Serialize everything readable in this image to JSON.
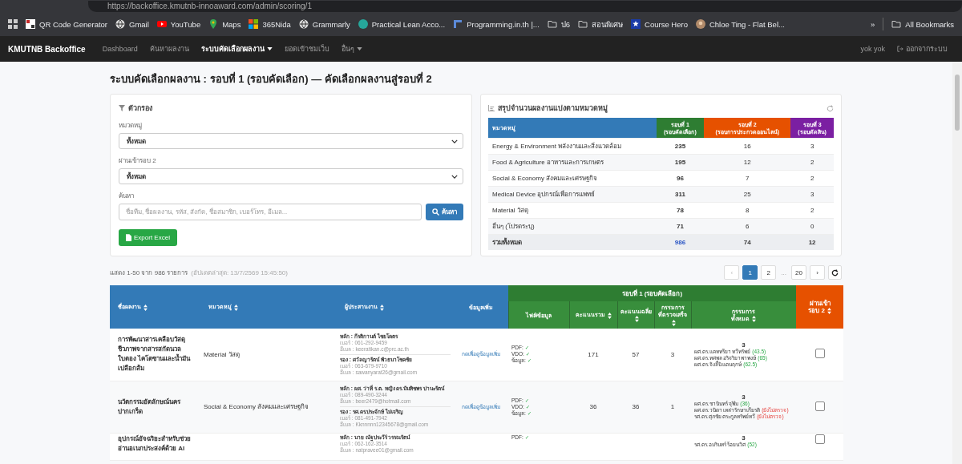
{
  "browser": {
    "url": "https://backoffice.kmutnb-innoaward.com/admin/scoring/1",
    "bookmarks": [
      {
        "label": "QR Code Generator",
        "kind": "qr"
      },
      {
        "label": "Gmail",
        "kind": "globe"
      },
      {
        "label": "YouTube",
        "kind": "play"
      },
      {
        "label": "Maps",
        "kind": "pin"
      },
      {
        "label": "365Nida",
        "kind": "grid"
      },
      {
        "label": "Grammarly",
        "kind": "globe"
      },
      {
        "label": "Practical Lean Acco...",
        "kind": "app"
      },
      {
        "label": "Programming.in.th |...",
        "kind": "page"
      },
      {
        "label": "ป6",
        "kind": "folder"
      },
      {
        "label": "สอนพิเศษ",
        "kind": "folder"
      },
      {
        "label": "Course Hero",
        "kind": "star"
      },
      {
        "label": "Chloe Ting - Flat Bel...",
        "kind": "avatar"
      }
    ],
    "more": "»",
    "all_bookmarks": "All Bookmarks"
  },
  "navbar": {
    "brand": "KMUTNB Backoffice",
    "items": [
      {
        "label": "Dashboard",
        "selected": false,
        "dropdown": false
      },
      {
        "label": "ค้นหาผลงาน",
        "selected": false,
        "dropdown": false
      },
      {
        "label": "ระบบคัดเลือกผลงาน",
        "selected": true,
        "dropdown": true
      },
      {
        "label": "ยอดเข้าชมเว็บ",
        "selected": false,
        "dropdown": false
      },
      {
        "label": "อื่นๆ",
        "selected": false,
        "dropdown": true
      }
    ],
    "user": "yok yok",
    "logout": "ออกจากระบบ"
  },
  "page_title": "ระบบคัดเลือกผลงาน : รอบที่ 1 (รอบคัดเลือก) — คัดเลือกผลงานสู่รอบที่ 2",
  "filter": {
    "title": "ตัวกรอง",
    "selects": [
      {
        "label": "หมวดหมู่",
        "value": "ทั้งหมด"
      },
      {
        "label": "ผ่านเข้ารอบ 2",
        "value": "ทั้งหมด"
      }
    ],
    "search_label": "ค้นหา",
    "search_placeholder": "ชื่อทีม, ชื่อผลงาน, รหัส, สังกัด, ชื่อสมาชิก, เบอร์โทร, อีเมล...",
    "search_button": "ค้นหา",
    "export_button": "Export Excel"
  },
  "summary": {
    "title": "สรุปจำนวนผลงานแบ่งตามหมวดหมู่",
    "columns": [
      {
        "lines": [
          "หมวดหมู่"
        ],
        "color": "#337ab7"
      },
      {
        "lines": [
          "รอบที่ 1",
          "(รอบคัดเลือก)"
        ],
        "color": "#2e7d32"
      },
      {
        "lines": [
          "รอบที่ 2",
          "(รอบการประกวดออนไลน์)"
        ],
        "color": "#e65100"
      },
      {
        "lines": [
          "รอบที่ 3",
          "(รอบตัดสิน)"
        ],
        "color": "#7b1fa2"
      }
    ],
    "rows": [
      {
        "category": "Energy & Environment พลังงานและสิ่งแวดล้อม",
        "r1": "235",
        "r2": "16",
        "r3": "3"
      },
      {
        "category": "Food & Agriculture อาหารและการเกษตร",
        "r1": "195",
        "r2": "12",
        "r3": "2"
      },
      {
        "category": "Social & Economy สังคมและเศรษฐกิจ",
        "r1": "96",
        "r2": "7",
        "r3": "2"
      },
      {
        "category": "Medical Device อุปกรณ์เพื่อการแพทย์",
        "r1": "311",
        "r2": "25",
        "r3": "3"
      },
      {
        "category": "Material วัสดุ",
        "r1": "78",
        "r2": "8",
        "r3": "2"
      },
      {
        "category": "อื่นๆ (โปรดระบุ)",
        "r1": "71",
        "r2": "6",
        "r3": "0"
      }
    ],
    "total": {
      "label": "รวมทั้งหมด",
      "r1": "986",
      "r2": "74",
      "r3": "12"
    }
  },
  "listing": {
    "count": "แสดง 1-50 จาก 986 รายการ",
    "updated": "(อัปเดตล่าสุด: 13/7/2569 15:45:50)"
  },
  "pagination": {
    "prev": "‹",
    "pages": [
      {
        "label": "1",
        "selected": true
      },
      {
        "label": "2",
        "selected": false
      }
    ],
    "ellipsis": "...",
    "last": {
      "label": "20",
      "selected": false
    },
    "next": "›"
  },
  "table": {
    "columns": [
      {
        "lines": [
          "ชื่อผลงาน"
        ],
        "sortable": true
      },
      {
        "lines": [
          "หมวดหมู่"
        ],
        "sortable": true
      },
      {
        "lines": [
          "ผู้ประสานงาน"
        ],
        "sortable": true
      },
      {
        "lines": [
          "ข้อมูลเพิ่ม"
        ],
        "sortable": false
      }
    ],
    "group": {
      "label": "รอบที่ 1 (รอบคัดเลือก)",
      "columns": [
        {
          "lines": [
            "ไฟล์/ข้อมูล"
          ],
          "sortable": false
        },
        {
          "lines": [
            "คะแนนรวม"
          ],
          "sortable": true
        },
        {
          "lines": [
            "คะแนนเฉลี่ย"
          ],
          "sortable": true
        },
        {
          "lines": [
            "กรรมการ",
            "ที่ตรวจเสร็จ"
          ],
          "sortable": true
        },
        {
          "lines": [
            "กรรมการ",
            "ทั้งหมด"
          ],
          "sortable": true
        }
      ]
    },
    "pass_column": {
      "lines": [
        "ผ่านเข้า",
        "รอบ 2"
      ],
      "sortable": true
    },
    "rows": [
      {
        "name": "การพัฒนาสารเคลือบวัสดุชีวภาพจากสารสกัดนวลใบตอง ไคโตซานและน้ำมันเปลือกส้ม",
        "category": "Material วัสดุ",
        "contacts": [
          {
            "name": "หลัก : กีรติกานต์ ไชยโคตร",
            "phone": "เบอร์ : 061-292-9459",
            "email": "อีเมล : keeratikan.c@prc.ac.th"
          },
          {
            "name": "รอง : ศวัลญารัตน์ พัวธนาโชคชัย",
            "phone": "เบอร์ : 063-679-9710",
            "email": "อีเมล : sawanyarat26@gmail.com"
          }
        ],
        "more_link": "กดเพื่อดูข้อมูลเพิ่ม",
        "files": [
          {
            "label": "PDF:",
            "mark": "✓"
          },
          {
            "label": "VDO:",
            "mark": "✓"
          },
          {
            "label": "ข้อมูล:",
            "mark": "✓"
          }
        ],
        "total": "171",
        "average": "57",
        "done": "3",
        "committee_count": "3",
        "committee": [
          {
            "name": "ผศ.ดร.แคททรียา ทวีทรัพย์",
            "score": "(43.5)",
            "kind": "scored"
          },
          {
            "name": "ผศ.ดร.ทศพล อริจริยาพาพงษ์",
            "score": "(65)",
            "kind": "scored"
          },
          {
            "name": "ผศ.ดร.จิงลี้นิ แดนฤกษ์",
            "score": "(62.5)",
            "kind": "scored"
          }
        ],
        "passed": false
      },
      {
        "name": "นวัตกรรมอัตลักษณ์นครปากเกร็ด",
        "category": "Social & Economy สังคมและเศรษฐกิจ",
        "contacts": [
          {
            "name": "หลัก : ผศ. ว่าที่ ร.ต. หญิง ดร.นันทิชพร ปานะรัตน์",
            "phone": "เบอร์ : 089-490-3244",
            "email": "อีเมล : beer2479@hotmail.com"
          },
          {
            "name": "รอง : รศ.ดร.ประจักษ์ ไม่เจริญ",
            "phone": "เบอร์ : 081-491-7942",
            "email": "อีเมล : Kknnnnn12345678@gmail.com"
          }
        ],
        "more_link": "กดเพื่อดูข้อมูลเพิ่ม",
        "files": [
          {
            "label": "PDF:",
            "mark": "✓"
          },
          {
            "label": "VDO:",
            "mark": "✓"
          },
          {
            "label": "ข้อมูล:",
            "mark": "✓"
          }
        ],
        "total": "36",
        "average": "36",
        "done": "1",
        "committee_count": "3",
        "committee": [
          {
            "name": "ผศ.ดร.ชานินทร์ จุฬิม",
            "score": "(36)",
            "kind": "scored"
          },
          {
            "name": "ผศ.ดร.วนิดา เหล่ารักษาเกียรติ",
            "score": "(ยังไม่ตรวจ)",
            "kind": "pending"
          },
          {
            "name": "รศ.ดร.ศุภชัย ตระกูลทรัพย์ทวี",
            "score": "(ยังไม่ตรวจ)",
            "kind": "pending"
          }
        ],
        "passed": false
      },
      {
        "name": "อุปกรณ์อัจฉริยะสำหรับช่วยอ่านอเนกประสงค์ด้วย AI",
        "contacts": [
          {
            "name": "หลัก : นาย ณัฐประวีร์ วรรณรัตน์",
            "phone": "เบอร์ : 062-162-3514",
            "email": "อีเมล : natpravee01@gmail.com"
          }
        ],
        "files": [
          {
            "label": "PDF:",
            "mark": "✓"
          }
        ],
        "committee_count": "3",
        "committee": [
          {
            "name": "รศ.ดร.อมรินทร์ ร้อยนวิศ",
            "score": "(52)",
            "kind": "scored"
          }
        ],
        "passed": false
      }
    ]
  }
}
